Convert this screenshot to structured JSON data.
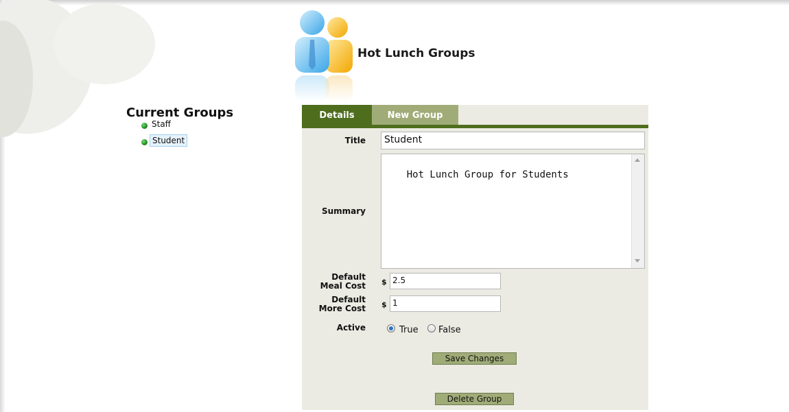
{
  "page": {
    "title": "Hot Lunch Groups"
  },
  "sidebar": {
    "title": "Current Groups",
    "items": [
      {
        "label": "Staff",
        "selected": false
      },
      {
        "label": "Student",
        "selected": true
      }
    ]
  },
  "tabs": [
    {
      "label": "Details",
      "active": true
    },
    {
      "label": "New Group",
      "active": false
    }
  ],
  "form": {
    "title_label": "Title",
    "title_value": "Student",
    "summary_label": "Summary",
    "summary_value": "Hot Lunch Group for Students",
    "meal_cost_label_1": "Default",
    "meal_cost_label_2": "Meal Cost",
    "meal_cost_currency": "$",
    "meal_cost_value": "2.5",
    "more_cost_label_1": "Default",
    "more_cost_label_2": "More Cost",
    "more_cost_currency": "$",
    "more_cost_value": "1",
    "active_label": "Active",
    "active_true_label": "True",
    "active_false_label": "False",
    "active_value": "True",
    "save_button": "Save Changes",
    "delete_button": "Delete Group"
  },
  "colors": {
    "tab_active": "#4e6d1d",
    "tab_inactive": "#9fac78",
    "panel_bg": "#ebebe3",
    "button_bg": "#9fac78"
  }
}
